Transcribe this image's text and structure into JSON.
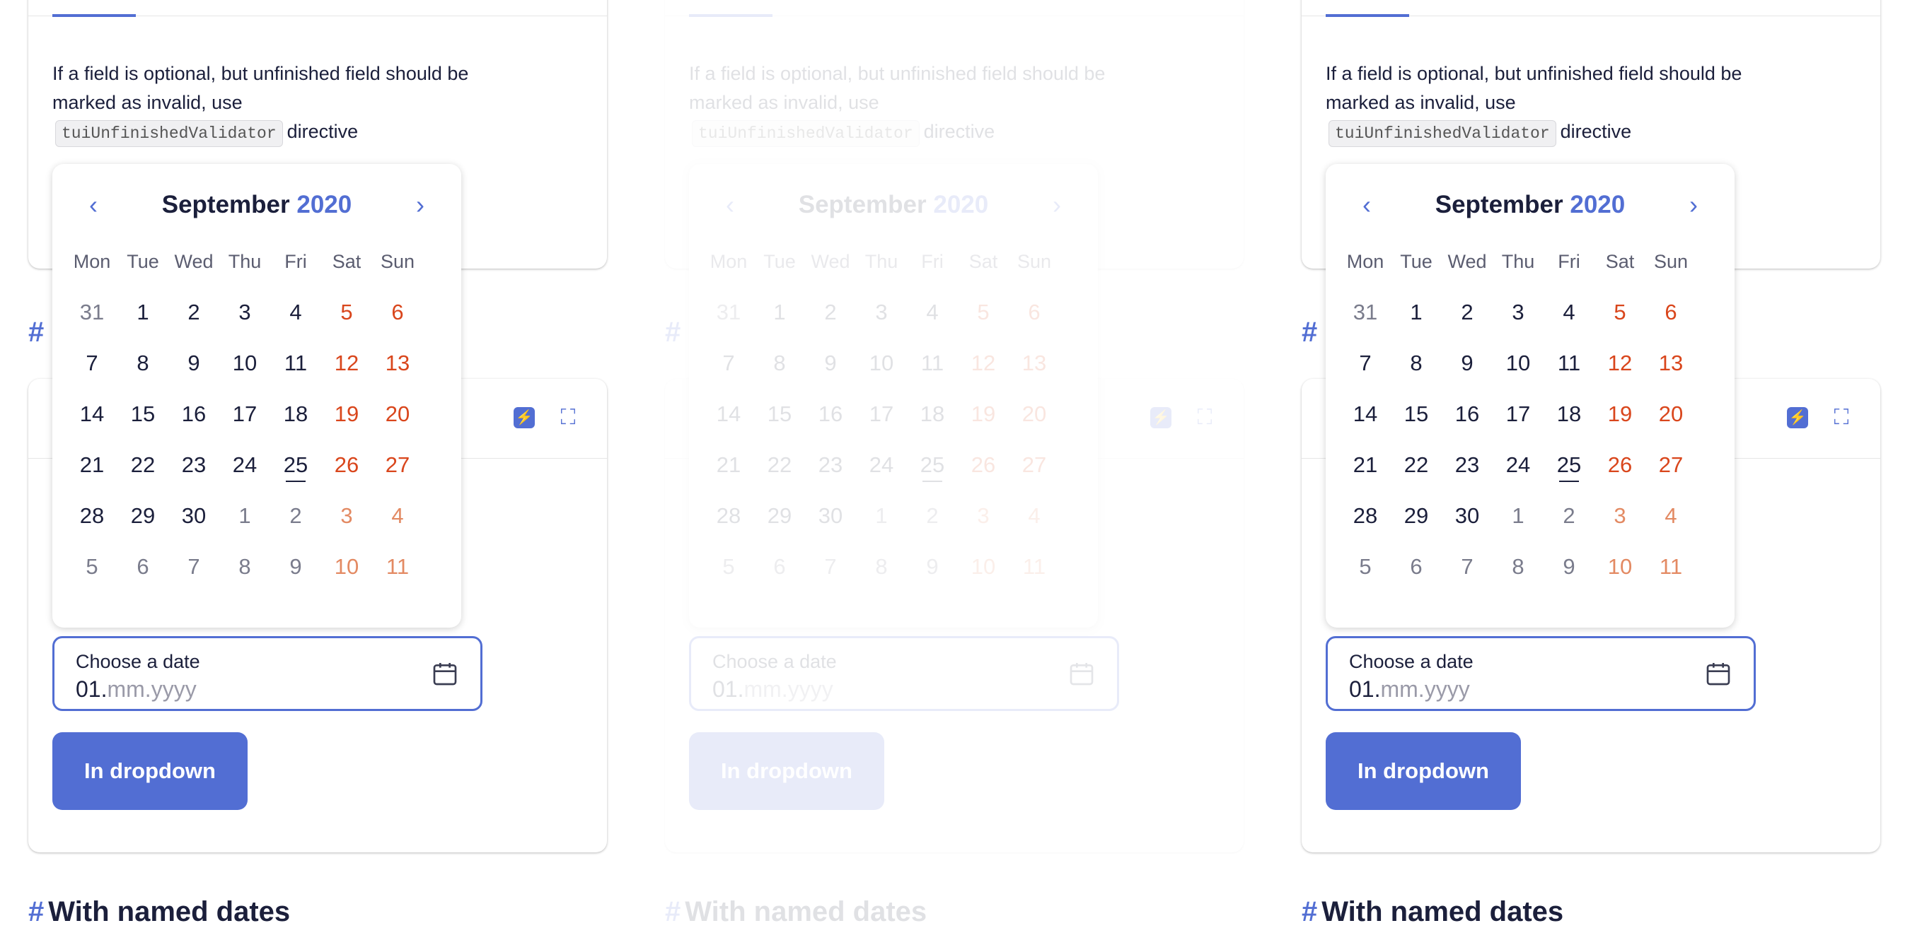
{
  "description": {
    "text_before": "If a field is optional, but unfinished field should be marked as invalid, use",
    "code": "tuiUnfinishedValidator",
    "text_after": "directive"
  },
  "calendar": {
    "month": "September",
    "year": "2020",
    "prev_icon": "chevron-left-icon",
    "next_icon": "chevron-right-icon",
    "weekdays": [
      "Mon",
      "Tue",
      "Wed",
      "Thu",
      "Fri",
      "Sat",
      "Sun"
    ],
    "today": "25",
    "weeks": [
      [
        "31",
        "1",
        "2",
        "3",
        "4",
        "5",
        "6"
      ],
      [
        "7",
        "8",
        "9",
        "10",
        "11",
        "12",
        "13"
      ],
      [
        "14",
        "15",
        "16",
        "17",
        "18",
        "19",
        "20"
      ],
      [
        "21",
        "22",
        "23",
        "24",
        "25",
        "26",
        "27"
      ],
      [
        "28",
        "29",
        "30",
        "1",
        "2",
        "3",
        "4"
      ],
      [
        "5",
        "6",
        "7",
        "8",
        "9",
        "10",
        "11"
      ]
    ]
  },
  "date_field": {
    "label": "Choose a date",
    "typed": "01.",
    "placeholder": "mm.yyyy",
    "icon": "calendar-icon"
  },
  "button": {
    "label": "In dropdown"
  },
  "section_heading": {
    "hash": "#",
    "text": "With named dates"
  },
  "peek_hash": "#",
  "header_icons": [
    "bolt-icon",
    "expand-icon"
  ],
  "colors": {
    "accent": "#526ed3",
    "weekend": "#d9461c",
    "text": "#1b1f3b"
  }
}
